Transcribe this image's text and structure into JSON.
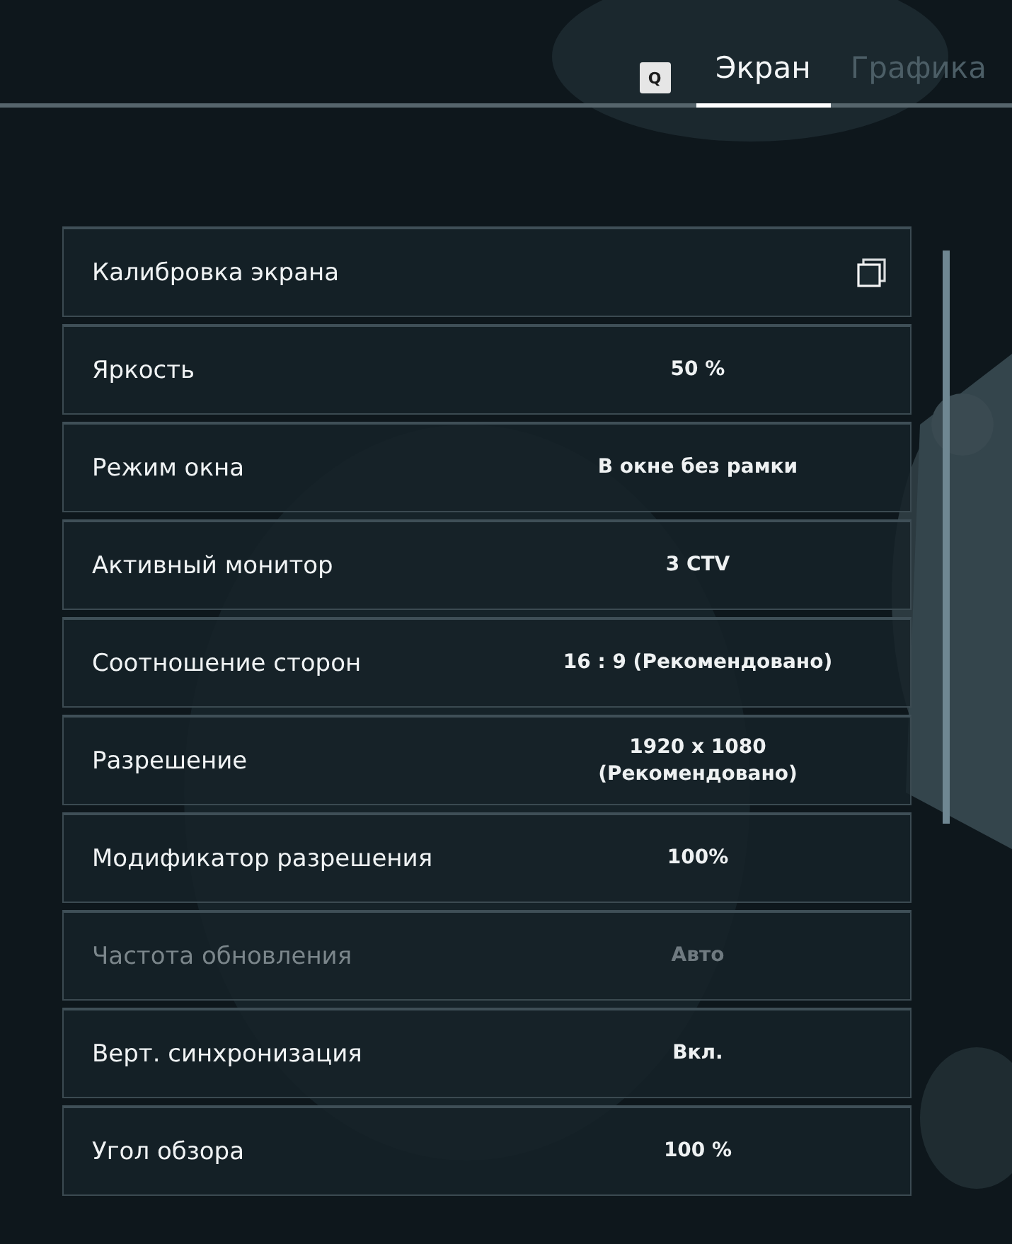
{
  "tabs_key": "Q",
  "tabs": [
    {
      "label": "Экран",
      "selected": true
    },
    {
      "label": "Графика",
      "selected": false
    }
  ],
  "settings": [
    {
      "label": "Калибровка экрана",
      "kind": "action",
      "disabled": false
    },
    {
      "label": "Яркость",
      "value": "50 %",
      "kind": "option",
      "disabled": false
    },
    {
      "label": "Режим окна",
      "value": "В окне без рамки",
      "kind": "option",
      "disabled": false
    },
    {
      "label": "Активный монитор",
      "value": "3 CTV",
      "kind": "option",
      "disabled": false
    },
    {
      "label": "Соотношение сторон",
      "value": "16 : 9 (Рекомендовано)",
      "kind": "option",
      "disabled": false
    },
    {
      "label": "Разрешение",
      "value": "1920 x 1080\n(Рекомендовано)",
      "kind": "option",
      "disabled": false
    },
    {
      "label": "Модификатор разрешения",
      "value": "100%",
      "kind": "option",
      "disabled": false
    },
    {
      "label": "Частота обновления",
      "value": "Авто",
      "kind": "option",
      "disabled": true
    },
    {
      "label": "Верт. синхронизация",
      "value": "Вкл.",
      "kind": "option",
      "disabled": false
    },
    {
      "label": "Угол обзора",
      "value": "100 %",
      "kind": "option",
      "disabled": false
    }
  ]
}
